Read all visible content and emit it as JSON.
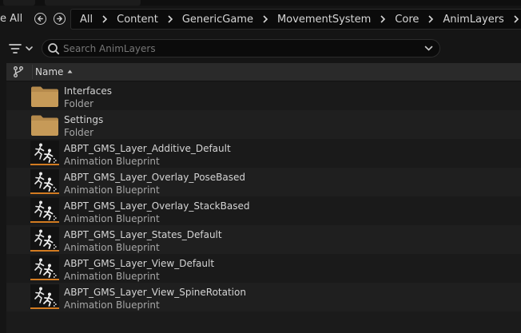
{
  "toolbar": {
    "save_all_label": "e All",
    "breadcrumb": [
      "All",
      "Content",
      "GenericGame",
      "MovementSystem",
      "Core",
      "AnimLayers"
    ]
  },
  "search": {
    "placeholder": "Search AnimLayers"
  },
  "list": {
    "column_name": "Name",
    "items": [
      {
        "name": "Interfaces",
        "type": "Folder",
        "kind": "folder"
      },
      {
        "name": "Settings",
        "type": "Folder",
        "kind": "folder"
      },
      {
        "name": "ABPT_GMS_Layer_Additive_Default",
        "type": "Animation Blueprint",
        "kind": "anim-blueprint"
      },
      {
        "name": "ABPT_GMS_Layer_Overlay_PoseBased",
        "type": "Animation Blueprint",
        "kind": "anim-blueprint"
      },
      {
        "name": "ABPT_GMS_Layer_Overlay_StackBased",
        "type": "Animation Blueprint",
        "kind": "anim-blueprint"
      },
      {
        "name": "ABPT_GMS_Layer_States_Default",
        "type": "Animation Blueprint",
        "kind": "anim-blueprint"
      },
      {
        "name": "ABPT_GMS_Layer_View_Default",
        "type": "Animation Blueprint",
        "kind": "anim-blueprint"
      },
      {
        "name": "ABPT_GMS_Layer_View_SpineRotation",
        "type": "Animation Blueprint",
        "kind": "anim-blueprint"
      }
    ]
  },
  "colors": {
    "folder": "#b58a4c",
    "anim_blueprint_accent": "#d27b21",
    "background": "#151515"
  }
}
